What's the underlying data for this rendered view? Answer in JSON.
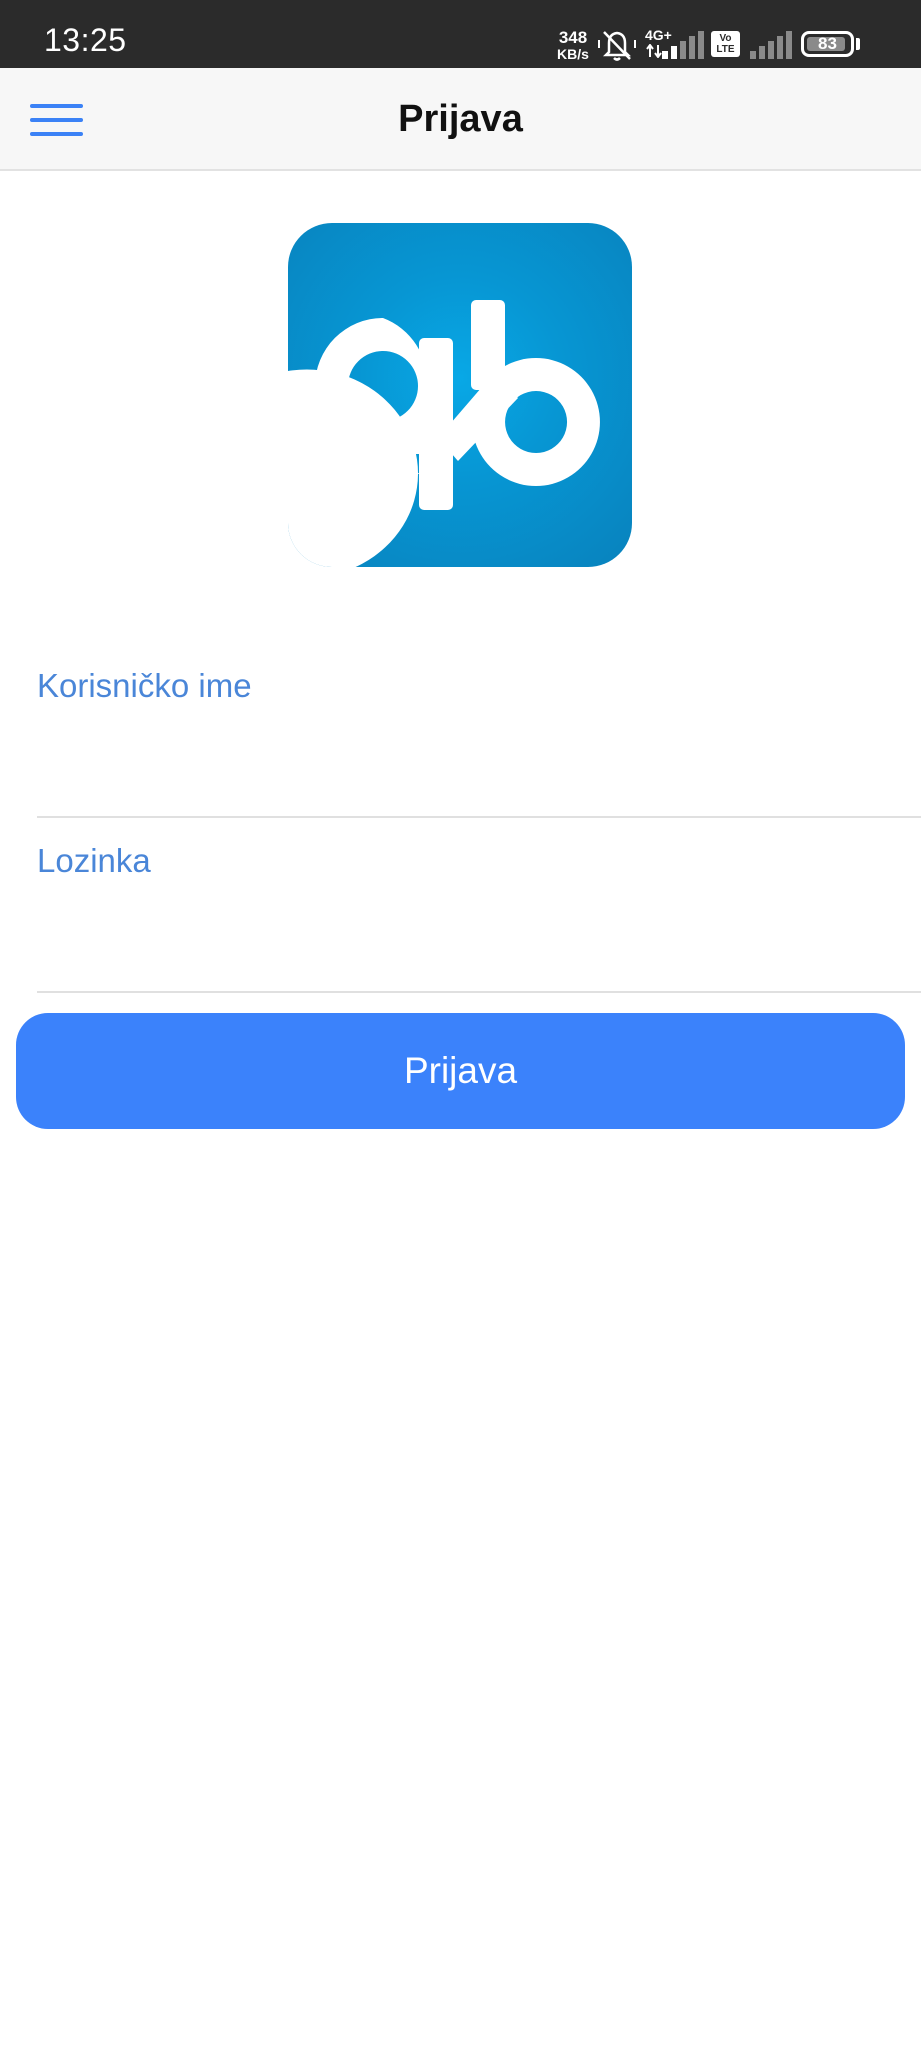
{
  "status_bar": {
    "time": "13:25",
    "net_speed_value": "348",
    "net_speed_unit": "KB/s",
    "network_type": "4G+",
    "volte_top": "Vo",
    "volte_bottom": "LTE",
    "battery_level": "83"
  },
  "header": {
    "title": "Prijava",
    "menu_icon": "hamburger-menu-icon"
  },
  "logo": {
    "letters": "ab",
    "background_color": "#0796d3"
  },
  "form": {
    "username_label": "Korisničko ime",
    "username_value": "",
    "password_label": "Lozinka",
    "password_value": "",
    "submit_label": "Prijava"
  },
  "colors": {
    "accent": "#3b82fb",
    "label": "#4a86d8",
    "status_bar": "#2b2b2b"
  }
}
